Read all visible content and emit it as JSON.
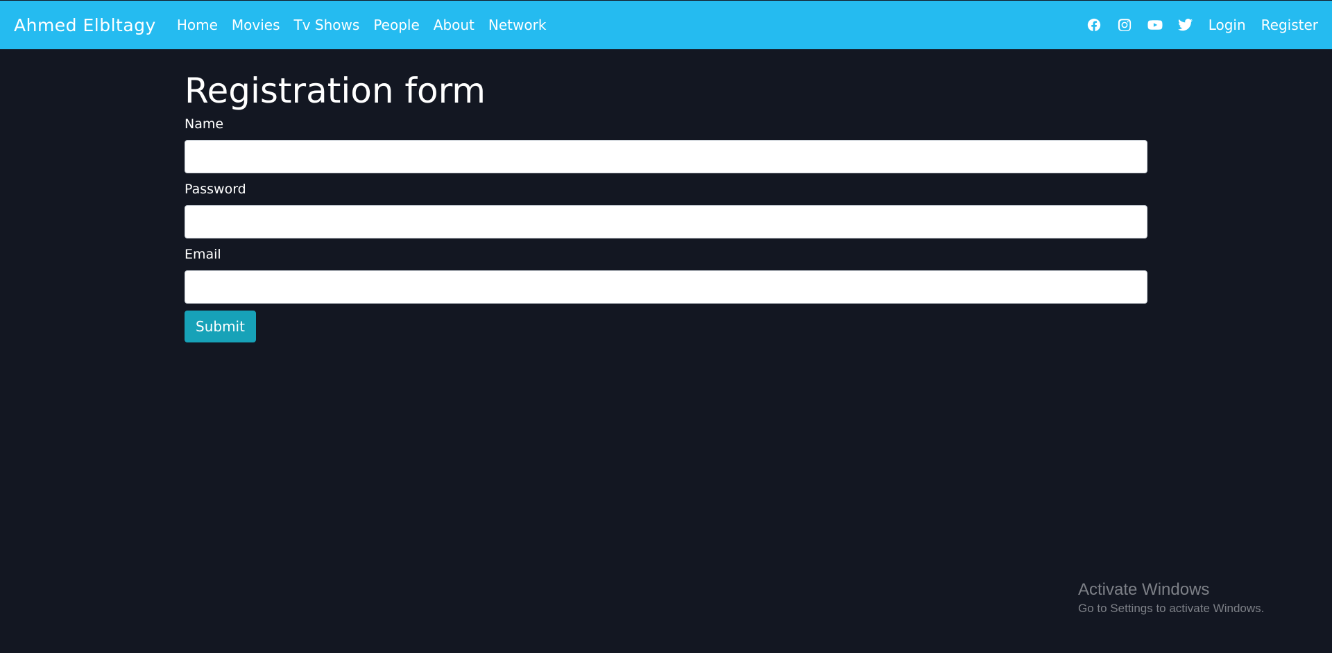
{
  "navbar": {
    "brand": "Ahmed Elbltagy",
    "links": [
      {
        "label": "Home"
      },
      {
        "label": "Movies"
      },
      {
        "label": "Tv Shows"
      },
      {
        "label": "People"
      },
      {
        "label": "About"
      },
      {
        "label": "Network"
      }
    ],
    "social_icons": [
      "facebook-icon",
      "instagram-icon",
      "youtube-icon",
      "twitter-icon"
    ],
    "login_label": "Login",
    "register_label": "Register",
    "bg_color": "#25bbf0"
  },
  "form": {
    "title": "Registration form",
    "fields": [
      {
        "label": "Name",
        "value": ""
      },
      {
        "label": "Password",
        "value": ""
      },
      {
        "label": "Email",
        "value": ""
      }
    ],
    "submit_label": "Submit",
    "submit_color": "#17a2b8"
  },
  "watermark": {
    "title": "Activate Windows",
    "subtitle": "Go to Settings to activate Windows."
  },
  "colors": {
    "page_bg": "#131722"
  }
}
